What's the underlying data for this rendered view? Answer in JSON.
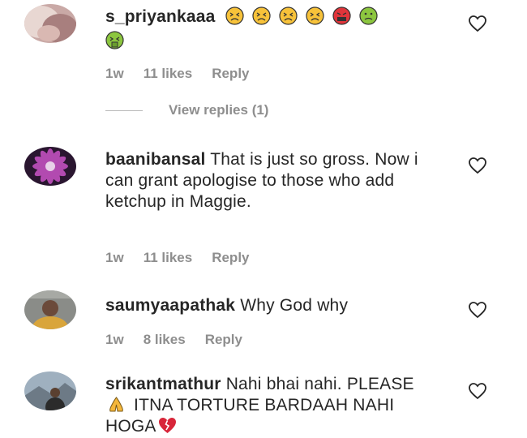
{
  "comments": [
    {
      "username": "s_priyankaaa",
      "text": "",
      "emojis": [
        "tired-face",
        "tired-face",
        "tired-face",
        "tired-face",
        "face-with-symbols",
        "nauseated-face",
        "face-vomiting"
      ],
      "time": "1w",
      "likes": "11 likes",
      "reply": "Reply",
      "view_replies": "View replies (1)"
    },
    {
      "username": "baanibansal",
      "text": "That is just so gross. Now i can grant apologise to those who add ketchup in Maggie.",
      "time": "1w",
      "likes": "11 likes",
      "reply": "Reply"
    },
    {
      "username": "saumyaapathak",
      "text": "Why God why",
      "time": "1w",
      "likes": "8 likes",
      "reply": "Reply"
    },
    {
      "username": "srikantmathur",
      "text_part1": "Nahi bhai nahi. PLEASE",
      "emoji1": "folded-hands",
      "text_part2": " ITNA TORTURE BARDAAH NAHI HOGA",
      "emoji2": "broken-heart"
    }
  ],
  "colors": {
    "text": "#262626",
    "meta": "#8e8e8e",
    "emoji_yellow": "#f7c23a",
    "emoji_red": "#e0353b",
    "emoji_green": "#8cc63f"
  }
}
